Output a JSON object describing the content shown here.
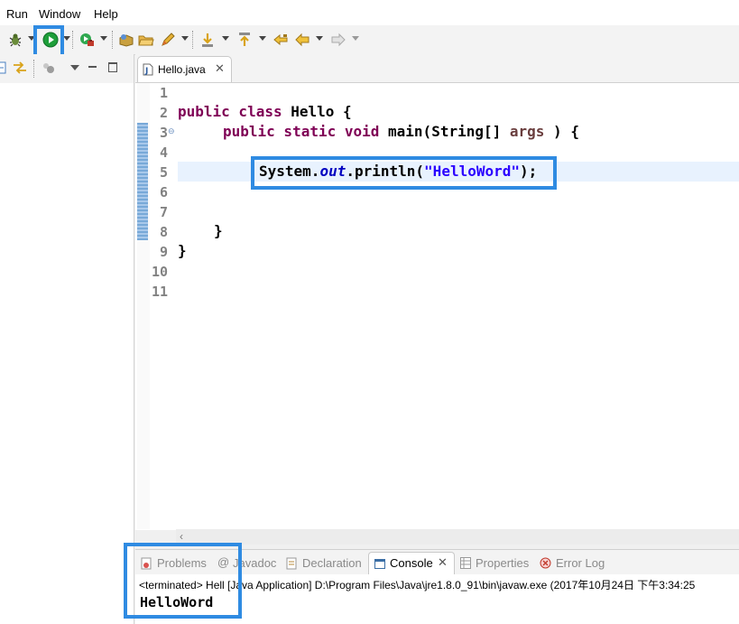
{
  "menu": {
    "items": [
      "Run",
      "Window",
      "Help"
    ]
  },
  "editor": {
    "tab_title": "Hello.java",
    "line_numbers": [
      "1",
      "2",
      "3",
      "4",
      "5",
      "6",
      "7",
      "8",
      "9",
      "10",
      "11"
    ],
    "code": {
      "l2_kw": "public class",
      "l2_rest": " Hello {",
      "l3_kw1": "public static void",
      "l3_mid": " main(String[] ",
      "l3_param": "args",
      "l3_end": " ) {",
      "l5_a": "System.",
      "l5_field": "out",
      "l5_b": ".println(",
      "l5_str": "\"HelloWord\"",
      "l5_c": ");",
      "l8": "}",
      "l9": "}"
    }
  },
  "bottom_panel": {
    "tabs": [
      "Problems",
      "Javadoc",
      "Declaration",
      "Console",
      "Properties",
      "Error Log"
    ],
    "console_status": "<terminated> Hell",
    "console_status_rest": " [Java Application] D:\\Program Files\\Java\\jre1.8.0_91\\bin\\javaw.exe (2017年10月24日 下午3:34:25",
    "console_output": "HelloWord"
  },
  "colors": {
    "highlight": "#2f8be2",
    "keyword": "#7f0055",
    "string": "#2a00ff",
    "field": "#0000c0",
    "run_green": "#1e9e3a"
  }
}
